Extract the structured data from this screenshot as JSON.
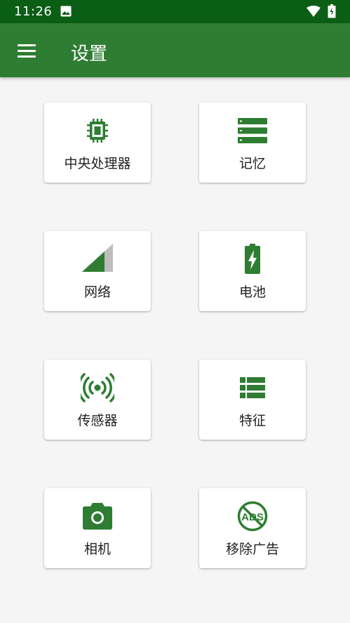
{
  "status_bar": {
    "time": "11:26"
  },
  "app_bar": {
    "title": "设置"
  },
  "colors": {
    "primary": "#2e7d32",
    "status_bar": "#0b5e15",
    "icon_green": "#2e7d32"
  },
  "grid": [
    {
      "label": "中央处理器",
      "icon": "cpu-icon"
    },
    {
      "label": "记忆",
      "icon": "memory-icon"
    },
    {
      "label": "网络",
      "icon": "signal-icon"
    },
    {
      "label": "电池",
      "icon": "battery-charging-icon"
    },
    {
      "label": "传感器",
      "icon": "sensors-icon"
    },
    {
      "label": "特征",
      "icon": "list-icon"
    },
    {
      "label": "相机",
      "icon": "camera-icon"
    },
    {
      "label": "移除广告",
      "icon": "no-ads-icon"
    }
  ]
}
